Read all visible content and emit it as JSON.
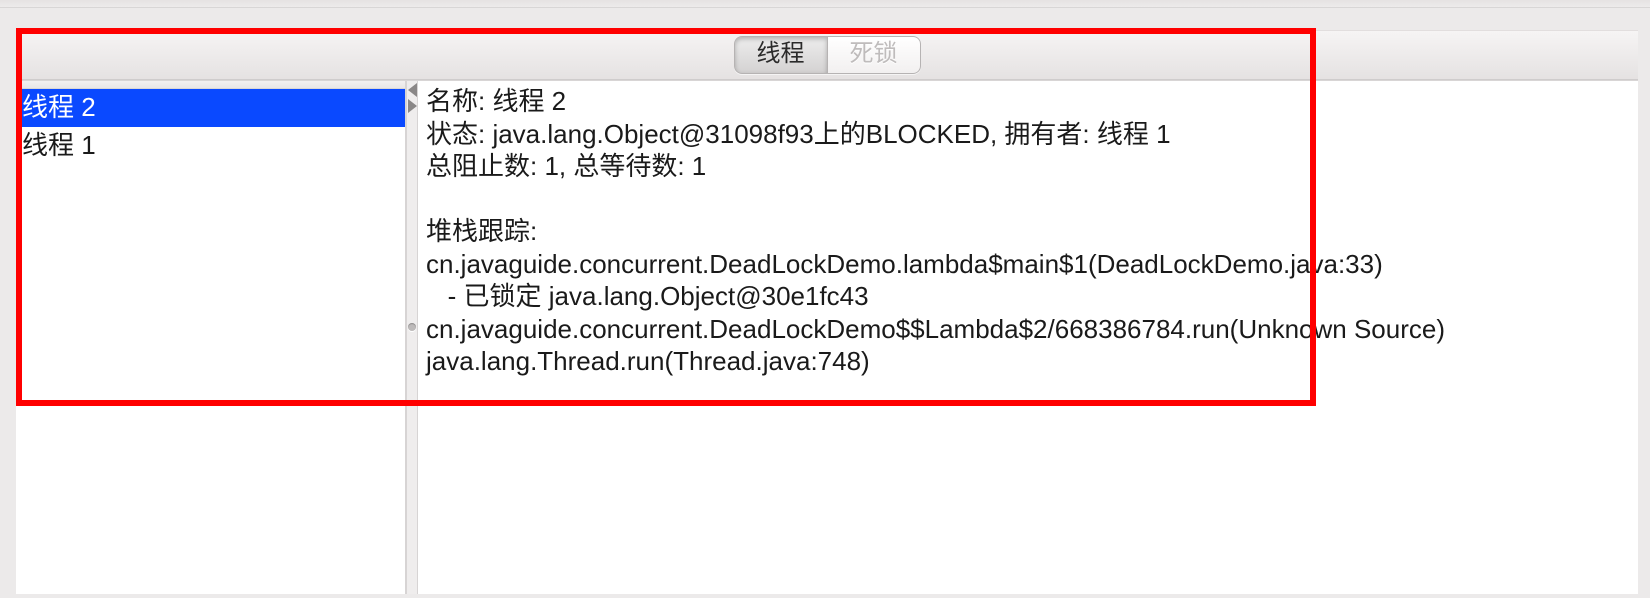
{
  "tabs": {
    "threads_label": "线程",
    "deadlock_label": "死锁"
  },
  "threads": [
    {
      "name": "线程 2"
    },
    {
      "name": "线程 1"
    }
  ],
  "selected_thread_index": 0,
  "detail": {
    "name_label": "名称:",
    "name_value": "线程 2",
    "state_label": "状态:",
    "state_value": "java.lang.Object@31098f93上的BLOCKED, 拥有者: 线程 1",
    "blocked_label": "总阻止数:",
    "blocked_value": "1",
    "waited_label": "总等待数:",
    "waited_value": "1",
    "stack_label": "堆栈跟踪:",
    "stack": [
      "cn.javaguide.concurrent.DeadLockDemo.lambda$main$1(DeadLockDemo.java:33)",
      "   - 已锁定 java.lang.Object@30e1fc43",
      "cn.javaguide.concurrent.DeadLockDemo$$Lambda$2/668386784.run(Unknown Source)",
      "java.lang.Thread.run(Thread.java:748)"
    ]
  }
}
